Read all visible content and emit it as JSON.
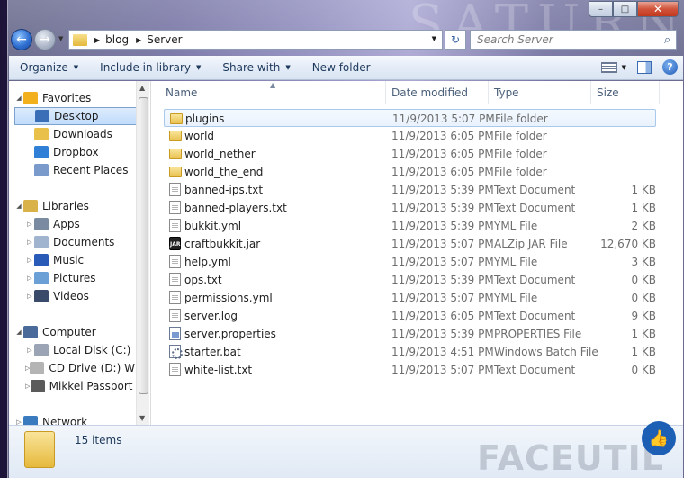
{
  "window": {
    "background_watermark": "SATURN",
    "caption": {
      "min": "–",
      "max": "□",
      "close": "✕"
    }
  },
  "nav": {
    "back_icon": "←",
    "forward_icon": "→",
    "breadcrumbs": [
      "blog",
      "Server"
    ],
    "search_placeholder": "Search Server",
    "refresh_icon": "↻",
    "search_icon": "⌕"
  },
  "toolbar": {
    "items": [
      {
        "label": "Organize",
        "has_arrow": true
      },
      {
        "label": "Include in library",
        "has_arrow": true
      },
      {
        "label": "Share with",
        "has_arrow": true
      },
      {
        "label": "New folder",
        "has_arrow": false
      }
    ],
    "help_label": "?"
  },
  "nav_pane": {
    "items": [
      {
        "label": "Favorites",
        "icon": "star",
        "expander": "◢",
        "level": 0,
        "selected": false
      },
      {
        "label": "Desktop",
        "icon": "desktop",
        "expander": "",
        "level": 1,
        "selected": true
      },
      {
        "label": "Downloads",
        "icon": "downloads-folder",
        "expander": "",
        "level": 1,
        "selected": false
      },
      {
        "label": "Dropbox",
        "icon": "dropbox",
        "expander": "",
        "level": 1,
        "selected": false
      },
      {
        "label": "Recent Places",
        "icon": "recent-places",
        "expander": "",
        "level": 1,
        "selected": false
      },
      {
        "label": "Libraries",
        "icon": "libraries",
        "expander": "◢",
        "level": 0,
        "selected": false
      },
      {
        "label": "Apps",
        "icon": "apps",
        "expander": "▷",
        "level": 1,
        "selected": false
      },
      {
        "label": "Documents",
        "icon": "documents",
        "expander": "▷",
        "level": 1,
        "selected": false
      },
      {
        "label": "Music",
        "icon": "music",
        "expander": "▷",
        "level": 1,
        "selected": false
      },
      {
        "label": "Pictures",
        "icon": "pictures",
        "expander": "▷",
        "level": 1,
        "selected": false
      },
      {
        "label": "Videos",
        "icon": "videos",
        "expander": "▷",
        "level": 1,
        "selected": false
      },
      {
        "label": "Computer",
        "icon": "computer",
        "expander": "◢",
        "level": 0,
        "selected": false
      },
      {
        "label": "Local Disk (C:)",
        "icon": "local-disk",
        "expander": "▷",
        "level": 1,
        "selected": false
      },
      {
        "label": "CD Drive (D:) WD",
        "icon": "cd-drive",
        "expander": "▷",
        "level": 1,
        "selected": false
      },
      {
        "label": "Mikkel Passport (",
        "icon": "external-drive",
        "expander": "▷",
        "level": 1,
        "selected": false
      },
      {
        "label": "Network",
        "icon": "network",
        "expander": "▷",
        "level": 0,
        "selected": false
      }
    ]
  },
  "columns": {
    "name": "Name",
    "date": "Date modified",
    "type": "Type",
    "size": "Size"
  },
  "files": [
    {
      "name": "plugins",
      "date": "11/9/2013 5:07 PM",
      "type": "File folder",
      "size": "",
      "icon": "folder",
      "selected": true
    },
    {
      "name": "world",
      "date": "11/9/2013 6:05 PM",
      "type": "File folder",
      "size": "",
      "icon": "folder",
      "selected": false
    },
    {
      "name": "world_nether",
      "date": "11/9/2013 6:05 PM",
      "type": "File folder",
      "size": "",
      "icon": "folder",
      "selected": false
    },
    {
      "name": "world_the_end",
      "date": "11/9/2013 6:05 PM",
      "type": "File folder",
      "size": "",
      "icon": "folder",
      "selected": false
    },
    {
      "name": "banned-ips.txt",
      "date": "11/9/2013 5:39 PM",
      "type": "Text Document",
      "size": "1 KB",
      "icon": "doc",
      "selected": false
    },
    {
      "name": "banned-players.txt",
      "date": "11/9/2013 5:39 PM",
      "type": "Text Document",
      "size": "1 KB",
      "icon": "doc",
      "selected": false
    },
    {
      "name": "bukkit.yml",
      "date": "11/9/2013 5:39 PM",
      "type": "YML File",
      "size": "2 KB",
      "icon": "doc",
      "selected": false
    },
    {
      "name": "craftbukkit.jar",
      "date": "11/9/2013 5:07 PM",
      "type": "ALZip JAR File",
      "size": "12,670 KB",
      "icon": "jar",
      "selected": false
    },
    {
      "name": "help.yml",
      "date": "11/9/2013 5:07 PM",
      "type": "YML File",
      "size": "3 KB",
      "icon": "doc",
      "selected": false
    },
    {
      "name": "ops.txt",
      "date": "11/9/2013 5:39 PM",
      "type": "Text Document",
      "size": "0 KB",
      "icon": "doc",
      "selected": false
    },
    {
      "name": "permissions.yml",
      "date": "11/9/2013 5:07 PM",
      "type": "YML File",
      "size": "0 KB",
      "icon": "doc",
      "selected": false
    },
    {
      "name": "server.log",
      "date": "11/9/2013 6:05 PM",
      "type": "Text Document",
      "size": "9 KB",
      "icon": "doc",
      "selected": false
    },
    {
      "name": "server.properties",
      "date": "11/9/2013 5:39 PM",
      "type": "PROPERTIES File",
      "size": "1 KB",
      "icon": "props",
      "selected": false
    },
    {
      "name": "starter.bat",
      "date": "11/9/2013 4:51 PM",
      "type": "Windows Batch File",
      "size": "1 KB",
      "icon": "bat",
      "selected": false
    },
    {
      "name": "white-list.txt",
      "date": "11/9/2013 5:07 PM",
      "type": "Text Document",
      "size": "0 KB",
      "icon": "doc",
      "selected": false
    }
  ],
  "status": {
    "item_count": "15 items",
    "watermark": "FACEUTIL",
    "like_icon": "👍"
  }
}
